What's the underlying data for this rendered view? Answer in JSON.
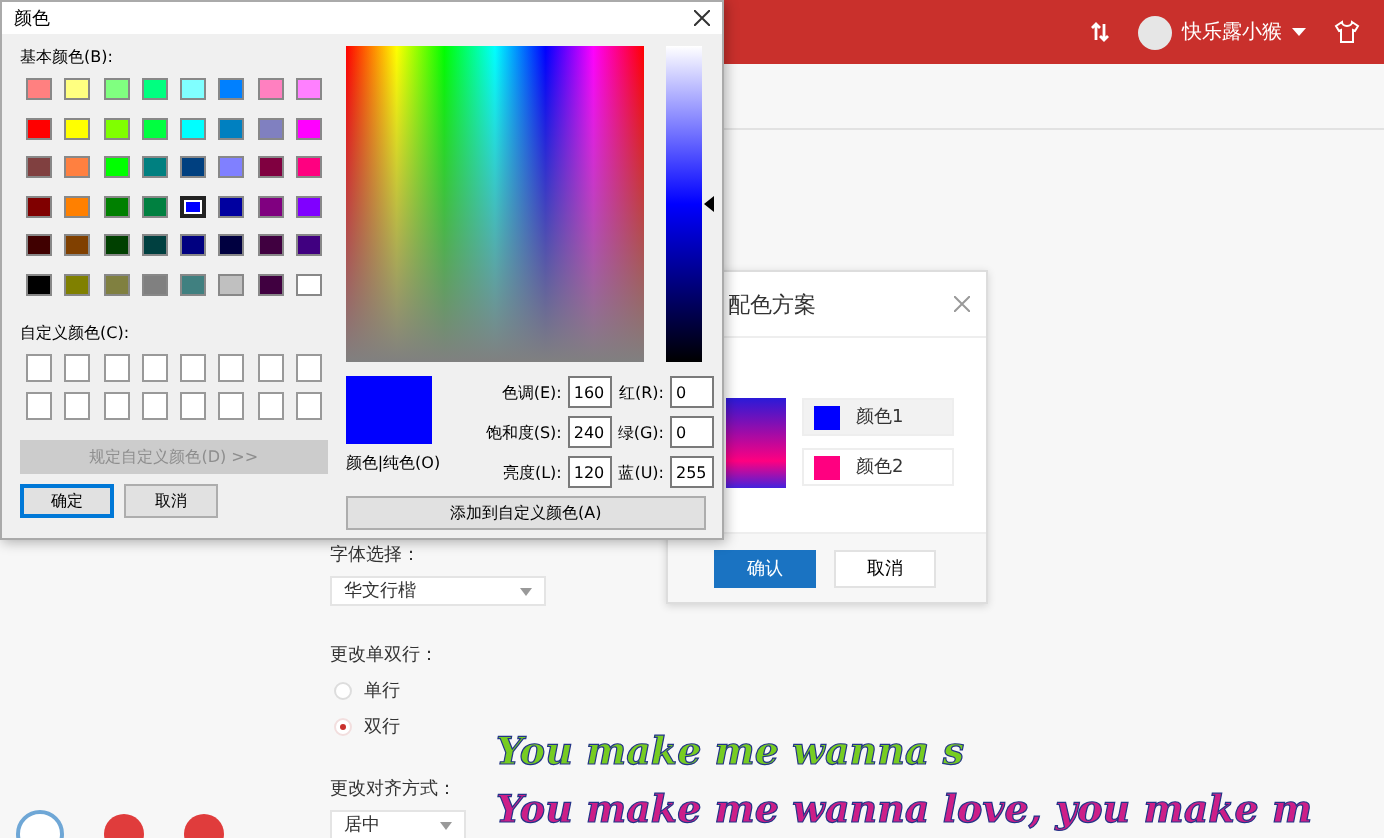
{
  "header": {
    "user": "快乐露小猴"
  },
  "form": {
    "font_label": "字体选择：",
    "font_select": "华文行楷",
    "lines_label": "更改单双行：",
    "line_options": [
      {
        "label": "单行",
        "selected": false
      },
      {
        "label": "双行",
        "selected": true
      }
    ],
    "align_label": "更改对齐方式：",
    "align_select": "居中"
  },
  "preview_lines": [
    {
      "text": "You make me wanna s",
      "color": "#77cc22"
    },
    {
      "text": "You make me wanna love, you make m",
      "color": "#cc1f88"
    }
  ],
  "scheme_dialog": {
    "title": "配色方案",
    "colors": [
      {
        "label": "颜色1",
        "color": "#0000ff",
        "selected": true
      },
      {
        "label": "颜色2",
        "color": "#ff0080",
        "selected": false
      }
    ],
    "confirm": "确认",
    "cancel": "取消"
  },
  "color_dialog": {
    "title": "颜色",
    "basic_label": "基本颜色(B):",
    "basic_colors": [
      {
        "color": "#ff8080",
        "selected": false
      },
      {
        "color": "#ffff80",
        "selected": false
      },
      {
        "color": "#80ff80",
        "selected": false
      },
      {
        "color": "#00ff80",
        "selected": false
      },
      {
        "color": "#80ffff",
        "selected": false
      },
      {
        "color": "#0080ff",
        "selected": false
      },
      {
        "color": "#ff80c0",
        "selected": false
      },
      {
        "color": "#ff80ff",
        "selected": false
      },
      {
        "color": "#ff0000",
        "selected": false
      },
      {
        "color": "#ffff00",
        "selected": false
      },
      {
        "color": "#80ff00",
        "selected": false
      },
      {
        "color": "#00ff40",
        "selected": false
      },
      {
        "color": "#00ffff",
        "selected": false
      },
      {
        "color": "#0080c0",
        "selected": false
      },
      {
        "color": "#8080c0",
        "selected": false
      },
      {
        "color": "#ff00ff",
        "selected": false
      },
      {
        "color": "#804040",
        "selected": false
      },
      {
        "color": "#ff8040",
        "selected": false
      },
      {
        "color": "#00ff00",
        "selected": false
      },
      {
        "color": "#008080",
        "selected": false
      },
      {
        "color": "#004080",
        "selected": false
      },
      {
        "color": "#8080ff",
        "selected": false
      },
      {
        "color": "#800040",
        "selected": false
      },
      {
        "color": "#ff0080",
        "selected": false
      },
      {
        "color": "#800000",
        "selected": false
      },
      {
        "color": "#ff8000",
        "selected": false
      },
      {
        "color": "#008000",
        "selected": false
      },
      {
        "color": "#008040",
        "selected": false
      },
      {
        "color": "#0000ff",
        "selected": true
      },
      {
        "color": "#0000a0",
        "selected": false
      },
      {
        "color": "#800080",
        "selected": false
      },
      {
        "color": "#8000ff",
        "selected": false
      },
      {
        "color": "#400000",
        "selected": false
      },
      {
        "color": "#804000",
        "selected": false
      },
      {
        "color": "#004000",
        "selected": false
      },
      {
        "color": "#004040",
        "selected": false
      },
      {
        "color": "#000080",
        "selected": false
      },
      {
        "color": "#000040",
        "selected": false
      },
      {
        "color": "#400040",
        "selected": false
      },
      {
        "color": "#400080",
        "selected": false
      },
      {
        "color": "#000000",
        "selected": false
      },
      {
        "color": "#808000",
        "selected": false
      },
      {
        "color": "#808040",
        "selected": false
      },
      {
        "color": "#808080",
        "selected": false
      },
      {
        "color": "#408080",
        "selected": false
      },
      {
        "color": "#c0c0c0",
        "selected": false
      },
      {
        "color": "#400040",
        "selected": false
      },
      {
        "color": "#ffffff",
        "selected": false
      }
    ],
    "custom_label": "自定义颜色(C):",
    "custom_colors": [
      {
        "color": "#ffffff"
      },
      {
        "color": "#ffffff"
      },
      {
        "color": "#ffffff"
      },
      {
        "color": "#ffffff"
      },
      {
        "color": "#ffffff"
      },
      {
        "color": "#ffffff"
      },
      {
        "color": "#ffffff"
      },
      {
        "color": "#ffffff"
      },
      {
        "color": "#ffffff"
      },
      {
        "color": "#ffffff"
      },
      {
        "color": "#ffffff"
      },
      {
        "color": "#ffffff"
      },
      {
        "color": "#ffffff"
      },
      {
        "color": "#ffffff"
      },
      {
        "color": "#ffffff"
      },
      {
        "color": "#ffffff"
      }
    ],
    "define_button": {
      "label": "规定自定义颜色(D) >>",
      "disabled": true
    },
    "ok": "确定",
    "cancel": "取消",
    "luminance": {
      "level": 0.5
    },
    "preview_label": "颜色|纯色(O)",
    "fields": [
      {
        "label": "色调(E):",
        "value": "160"
      },
      {
        "label": "红(R):",
        "value": "0"
      },
      {
        "label": "饱和度(S):",
        "value": "240"
      },
      {
        "label": "绿(G):",
        "value": "0"
      },
      {
        "label": "亮度(L):",
        "value": "120"
      },
      {
        "label": "蓝(U):",
        "value": "255"
      }
    ],
    "add_button": "添加到自定义颜色(A)"
  }
}
